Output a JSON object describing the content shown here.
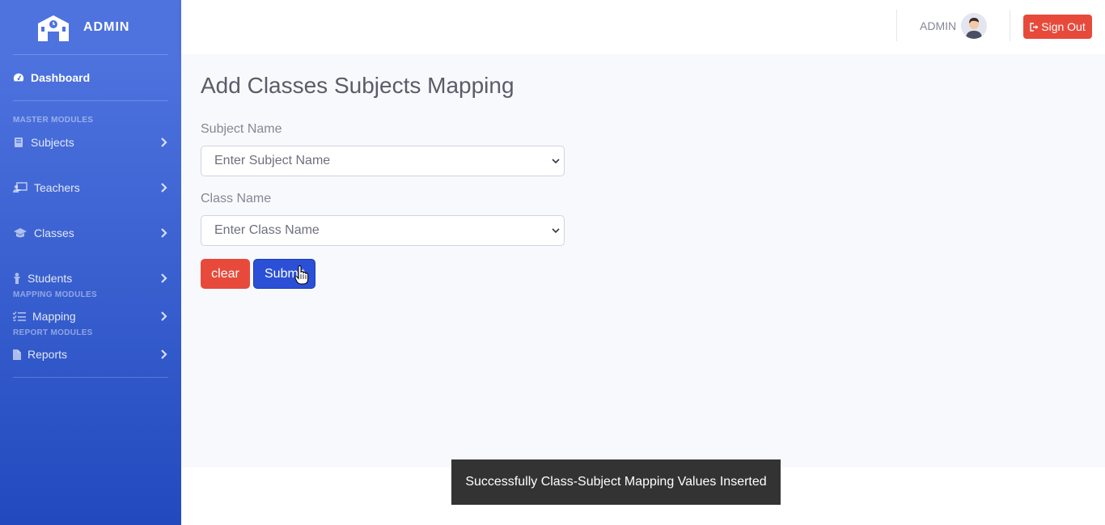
{
  "brand": {
    "title": "ADMIN",
    "icon": "school-building-icon"
  },
  "sidebar": {
    "dashboard": {
      "label": "Dashboard",
      "icon": "tachometer-icon"
    },
    "headings": {
      "master": "MASTER MODULES",
      "mapping": "MAPPING MODULES",
      "report": "REPORT MODULES"
    },
    "items": [
      {
        "label": "Subjects",
        "icon": "book-icon"
      },
      {
        "label": "Teachers",
        "icon": "chalkboard-teacher-icon"
      },
      {
        "label": "Classes",
        "icon": "graduation-cap-icon"
      },
      {
        "label": "Students",
        "icon": "student-icon"
      },
      {
        "label": "Mapping",
        "icon": "list-check-icon"
      },
      {
        "label": "Reports",
        "icon": "file-icon"
      }
    ]
  },
  "topbar": {
    "user_name": "ADMIN",
    "sign_out_label": "Sign Out"
  },
  "main": {
    "title": "Add Classes Subjects Mapping",
    "subject_label": "Subject Name",
    "subject_placeholder": "Enter Subject Name",
    "class_label": "Class Name",
    "class_placeholder": "Enter Class Name",
    "clear_label": "clear",
    "submit_label": "Submit"
  },
  "toast": {
    "message": "Successfully Class-Subject Mapping Values Inserted"
  },
  "colors": {
    "sidebar_top": "#4e73df",
    "sidebar_bottom": "#224abe",
    "danger": "#e74a3b",
    "primary": "#2b50d6",
    "toast_bg": "#333333"
  }
}
